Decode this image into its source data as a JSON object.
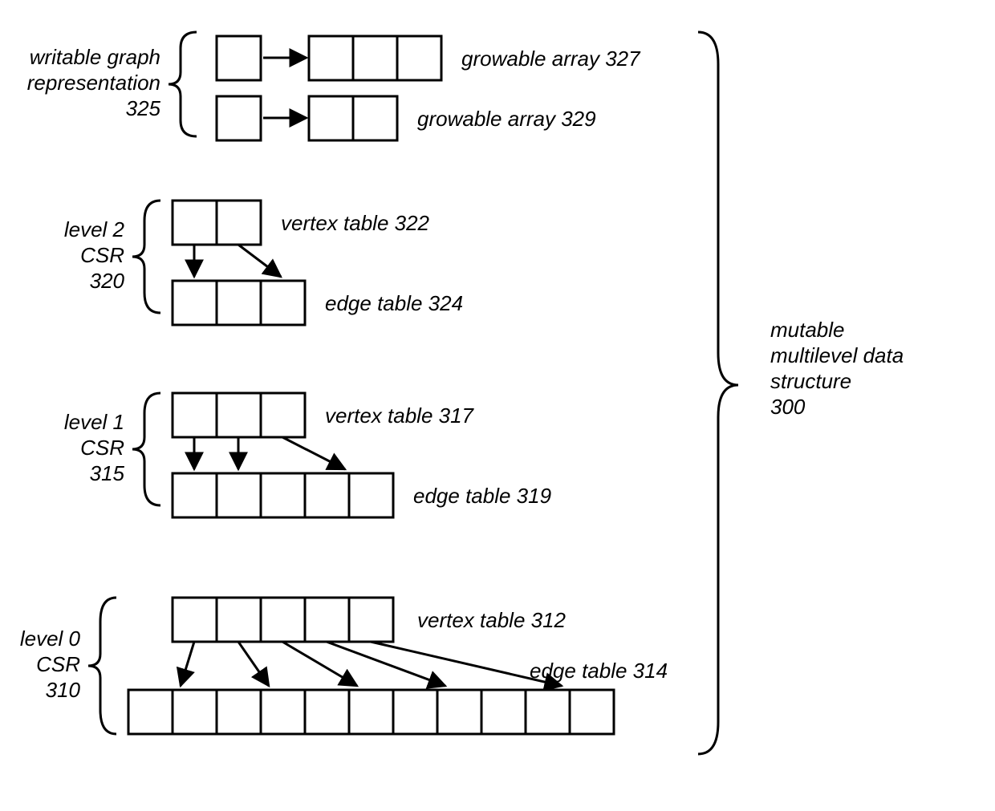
{
  "title_lines": [
    "mutable",
    "multilevel data",
    "structure",
    "300"
  ],
  "groups": {
    "writable": {
      "label_lines": [
        "writable graph",
        "representation",
        "325"
      ]
    },
    "level2": {
      "label_lines": [
        "level 2",
        "CSR",
        "320"
      ]
    },
    "level1": {
      "label_lines": [
        "level 1",
        "CSR",
        "315"
      ]
    },
    "level0": {
      "label_lines": [
        "level 0",
        "CSR",
        "310"
      ]
    }
  },
  "items": {
    "growable_327": "growable array 327",
    "growable_329": "growable array 329",
    "vertex_322": "vertex table 322",
    "edge_324": "edge table 324",
    "vertex_317": "vertex table 317",
    "edge_319": "edge table 319",
    "vertex_312": "vertex table 312",
    "edge_314": "edge table 314"
  }
}
